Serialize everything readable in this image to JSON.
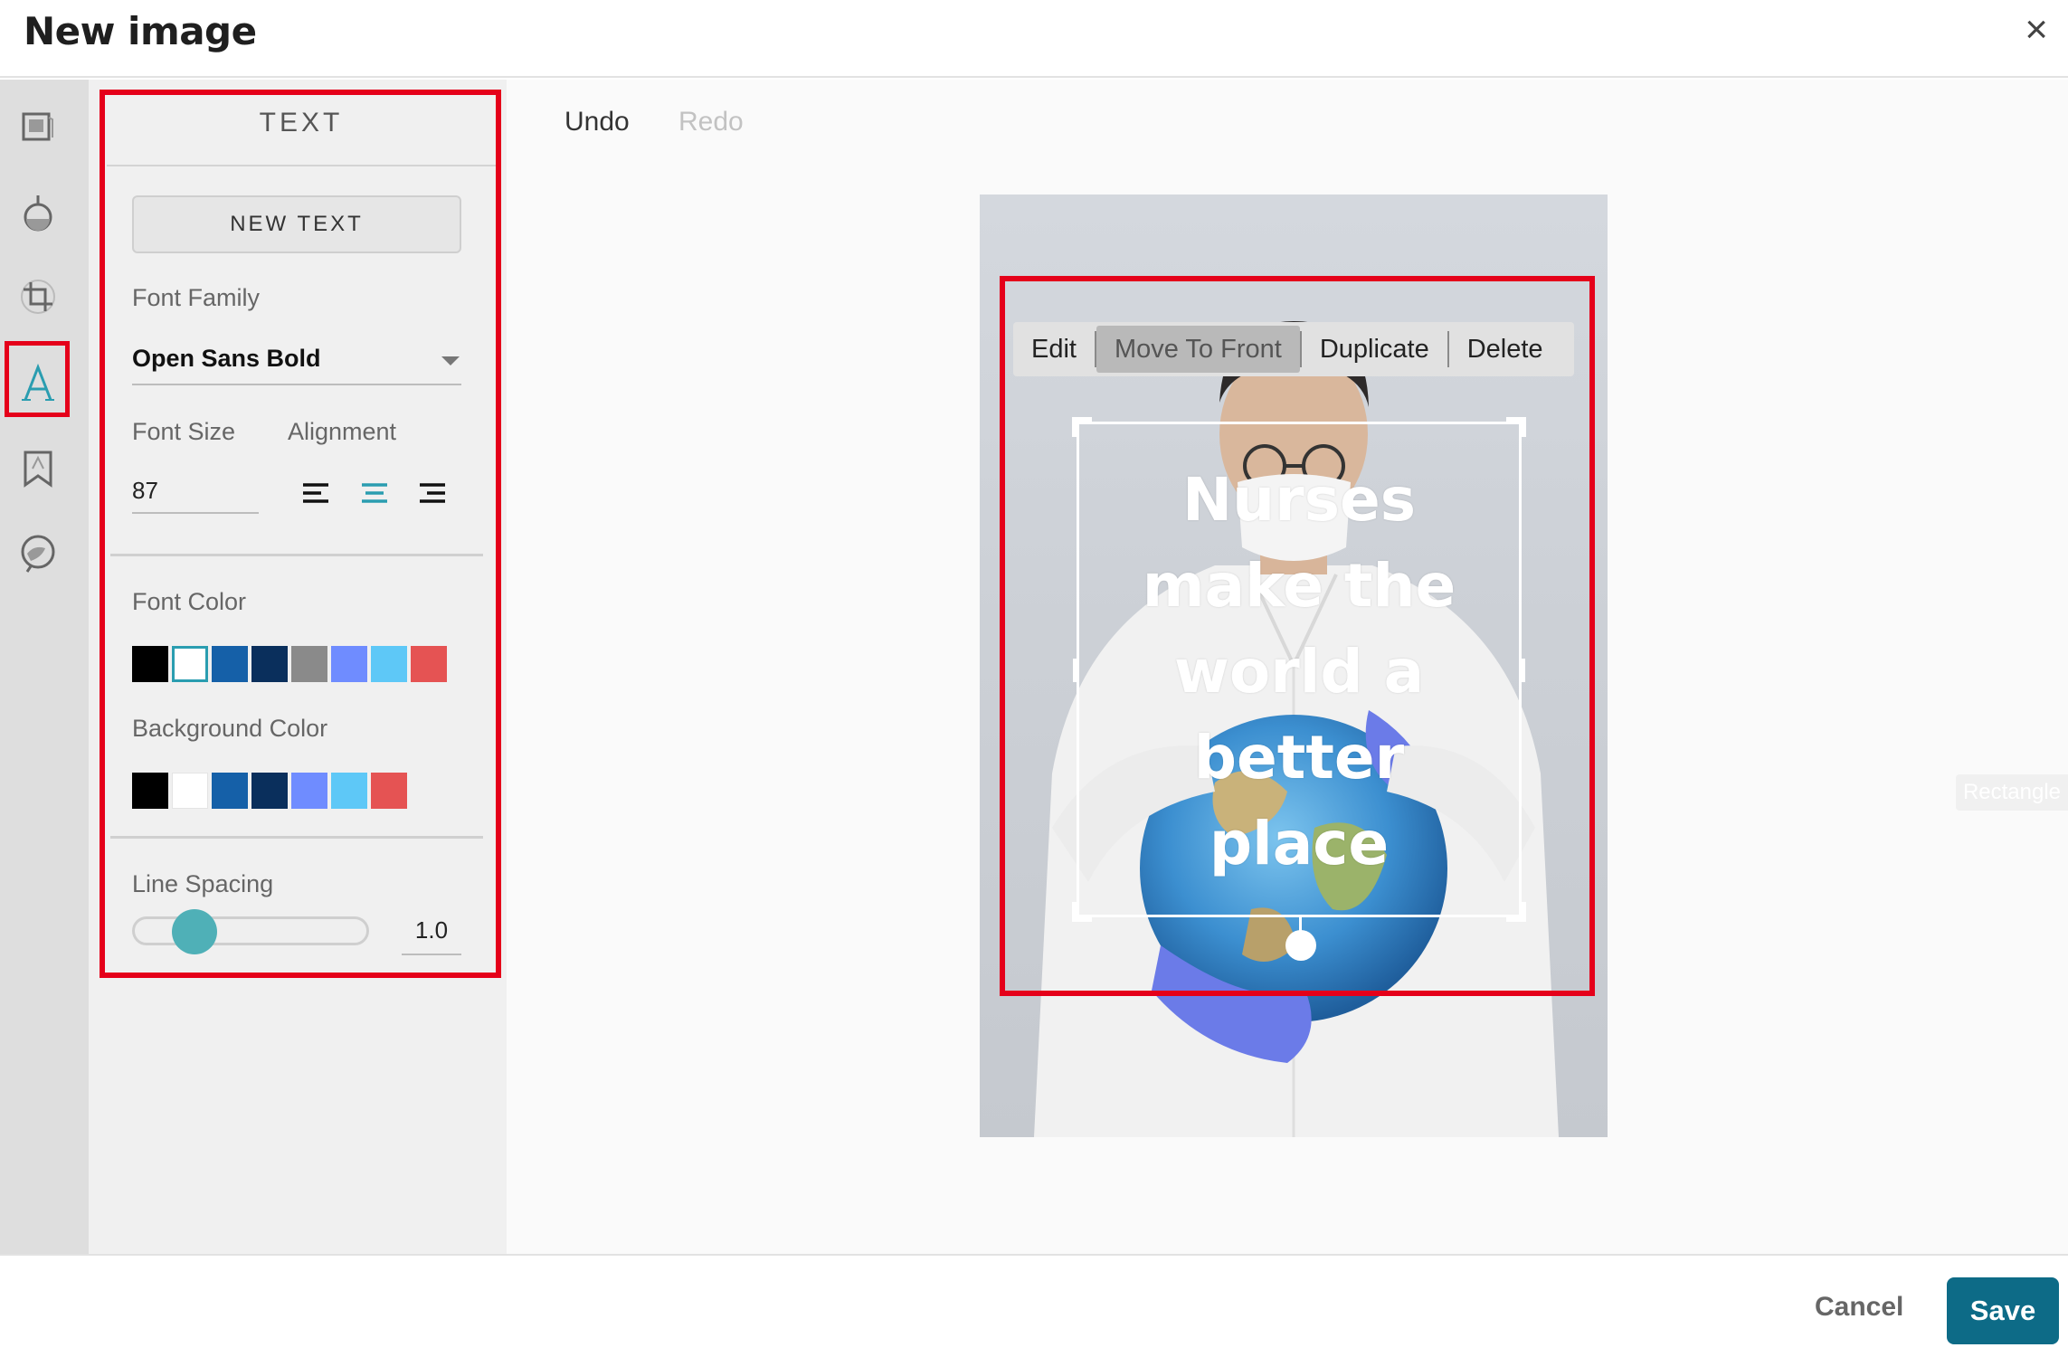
{
  "window": {
    "title": "New image",
    "close_label": "×"
  },
  "rail": {
    "items": [
      {
        "icon": "image-icon"
      },
      {
        "icon": "filter-icon"
      },
      {
        "icon": "crop-icon"
      },
      {
        "icon": "text-icon",
        "active": true
      },
      {
        "icon": "bookmark-icon"
      },
      {
        "icon": "sticker-icon"
      }
    ]
  },
  "panel": {
    "title": "TEXT",
    "new_text_label": "NEW TEXT",
    "font_family_label": "Font Family",
    "font_family_value": "Open Sans Bold",
    "font_size_label": "Font Size",
    "font_size_value": "87",
    "alignment_label": "Alignment",
    "alignment_selected": "center",
    "font_color_label": "Font Color",
    "font_colors": [
      "#000000",
      "#ffffff",
      "#1560a8",
      "#0a2f5c",
      "#8a8a8a",
      "#6f8cff",
      "#5ec8f7",
      "#e55353"
    ],
    "font_color_selected": "#ffffff",
    "background_color_label": "Background Color",
    "background_colors": [
      "#000000",
      "#ffffff",
      "#1560a8",
      "#0a2f5c",
      "#6f8cff",
      "#5ec8f7",
      "#e55353"
    ],
    "line_spacing_label": "Line Spacing",
    "line_spacing_value": "1.0"
  },
  "toolbar": {
    "undo_label": "Undo",
    "redo_label": "Redo"
  },
  "context_menu": {
    "edit": "Edit",
    "move_to_front": "Move To Front",
    "duplicate": "Duplicate",
    "delete": "Delete"
  },
  "text_box": {
    "lines": [
      "Nurses",
      "make the",
      "world a",
      "better",
      "place"
    ]
  },
  "side_tag": {
    "label": "Rectangle"
  },
  "footer": {
    "cancel_label": "Cancel",
    "save_label": "Save"
  },
  "colors": {
    "accent": "#0d6b87",
    "highlight": "#e5001a",
    "slider": "#4fb0b7"
  }
}
